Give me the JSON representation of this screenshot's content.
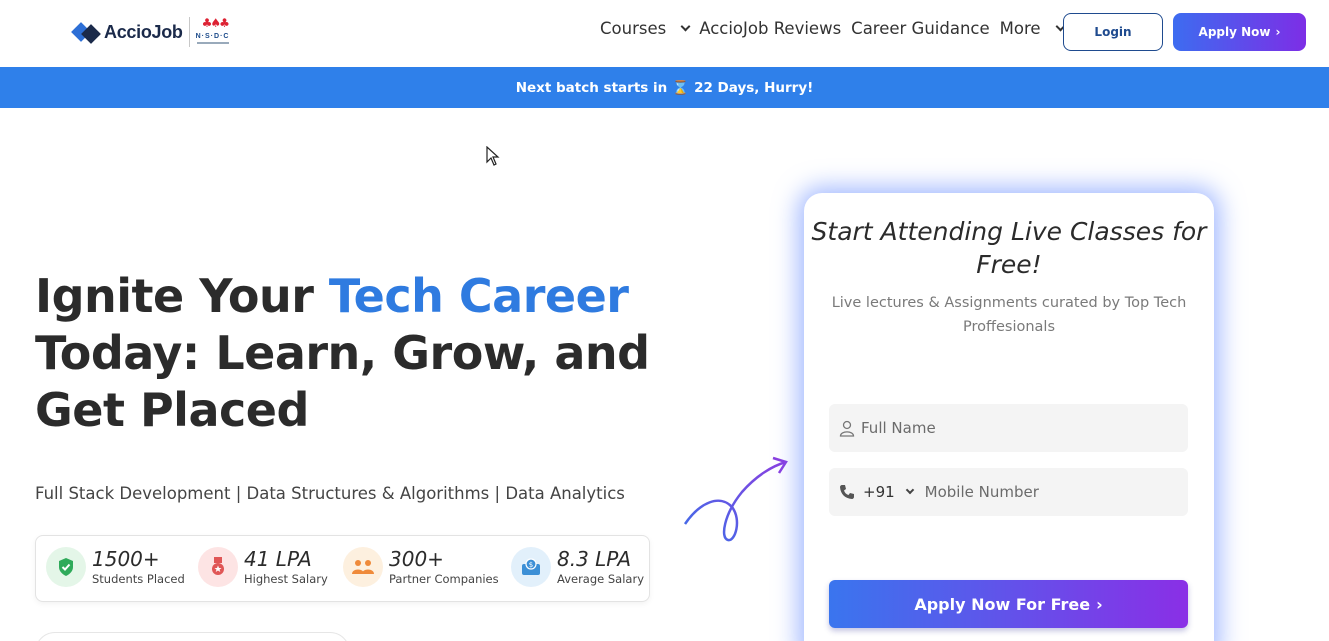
{
  "brand": {
    "logo_text": "AccioJob",
    "partner_logo": "N·S·D·C"
  },
  "nav": {
    "items": [
      {
        "label": "Courses",
        "has_dropdown": true
      },
      {
        "label": "AccioJob Reviews",
        "has_dropdown": false
      },
      {
        "label": "Career Guidance",
        "has_dropdown": false
      },
      {
        "label": "More",
        "has_dropdown": true
      }
    ],
    "login_label": "Login",
    "apply_label": "Apply Now"
  },
  "banner": {
    "prefix": "Next batch starts in",
    "icon": "hourglass-icon",
    "suffix": "22 Days, Hurry!"
  },
  "hero": {
    "title_part1": "Ignite Your ",
    "title_accent": "Tech Career",
    "title_part2": "Today: Learn, Grow, and Get Placed",
    "subline": "Full Stack Development | Data Structures & Algorithms | Data Analytics",
    "stats": [
      {
        "value": "1500+",
        "label": "Students Placed",
        "icon": "shield-check-icon",
        "bg": "#e4f6e8",
        "fg": "#2faa5a"
      },
      {
        "value": "41 LPA",
        "label": "Highest Salary",
        "icon": "medal-icon",
        "bg": "#fde4e4",
        "fg": "#e05656"
      },
      {
        "value": "300+",
        "label": "Partner Companies",
        "icon": "people-icon",
        "bg": "#fdf0df",
        "fg": "#ef8a3a"
      },
      {
        "value": "8.3 LPA",
        "label": "Average Salary",
        "icon": "salary-box-icon",
        "bg": "#e2f0fb",
        "fg": "#3c8fd6"
      }
    ]
  },
  "form": {
    "title": "Start Attending Live Classes for Free!",
    "subtitle": "Live lectures & Assignments curated by Top Tech Proffesionals",
    "name_placeholder": "Full Name",
    "country_code": "+91",
    "phone_placeholder": "Mobile Number",
    "submit_label": "Apply Now For Free"
  },
  "colors": {
    "accent_blue": "#2f7be0",
    "banner_bg": "#2f80ea",
    "cta_gradient_start": "#3a75ee",
    "cta_gradient_end": "#8a2fe6"
  }
}
